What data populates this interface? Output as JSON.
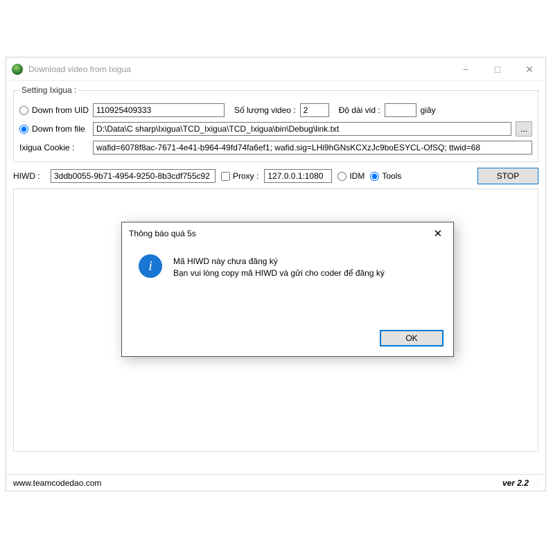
{
  "window": {
    "title": "Download video from Ixigua",
    "minimize": "−",
    "maximize": "□",
    "close": "✕"
  },
  "group": {
    "legend": "Setting Ixigua :",
    "down_from_uid_label": "Down from UID",
    "uid_value": "110925409333",
    "qty_label": "Số lượng video :",
    "qty_value": "2",
    "duration_label": "Độ dài vid :",
    "duration_value": "",
    "seconds_label": "giây",
    "down_from_file_label": "Down from file",
    "file_path": "D:\\Data\\C sharp\\Ixigua\\TCD_Ixigua\\TCD_Ixigua\\bin\\Debug\\link.txt",
    "browse_label": "...",
    "cookie_label": "Ixigua Cookie :",
    "cookie_value": "wafid=6078f8ac-7671-4e41-b964-49fd74fa6ef1; wafid.sig=LHi9hGNsKCXzJc9boESYCL-OfSQ; ttwid=68"
  },
  "hiwd": {
    "label": "HIWD :",
    "value": "3ddb0055-9b71-4954-9250-8b3cdf755c92",
    "proxy_label": "Proxy :",
    "proxy_value": "127.0.0.1:1080",
    "idm_label": "IDM",
    "tools_label": "Tools",
    "stop_label": "STOP"
  },
  "status": {
    "site": "www.teamcodedao.com",
    "version": "ver 2.2"
  },
  "modal": {
    "title": "Thông báo quá 5s",
    "close": "✕",
    "line1": "Mã HIWD này chưa đăng ký",
    "line2": "Bạn vui lòng copy mã HIWD và gửi cho coder để đăng ký",
    "ok": "OK"
  }
}
